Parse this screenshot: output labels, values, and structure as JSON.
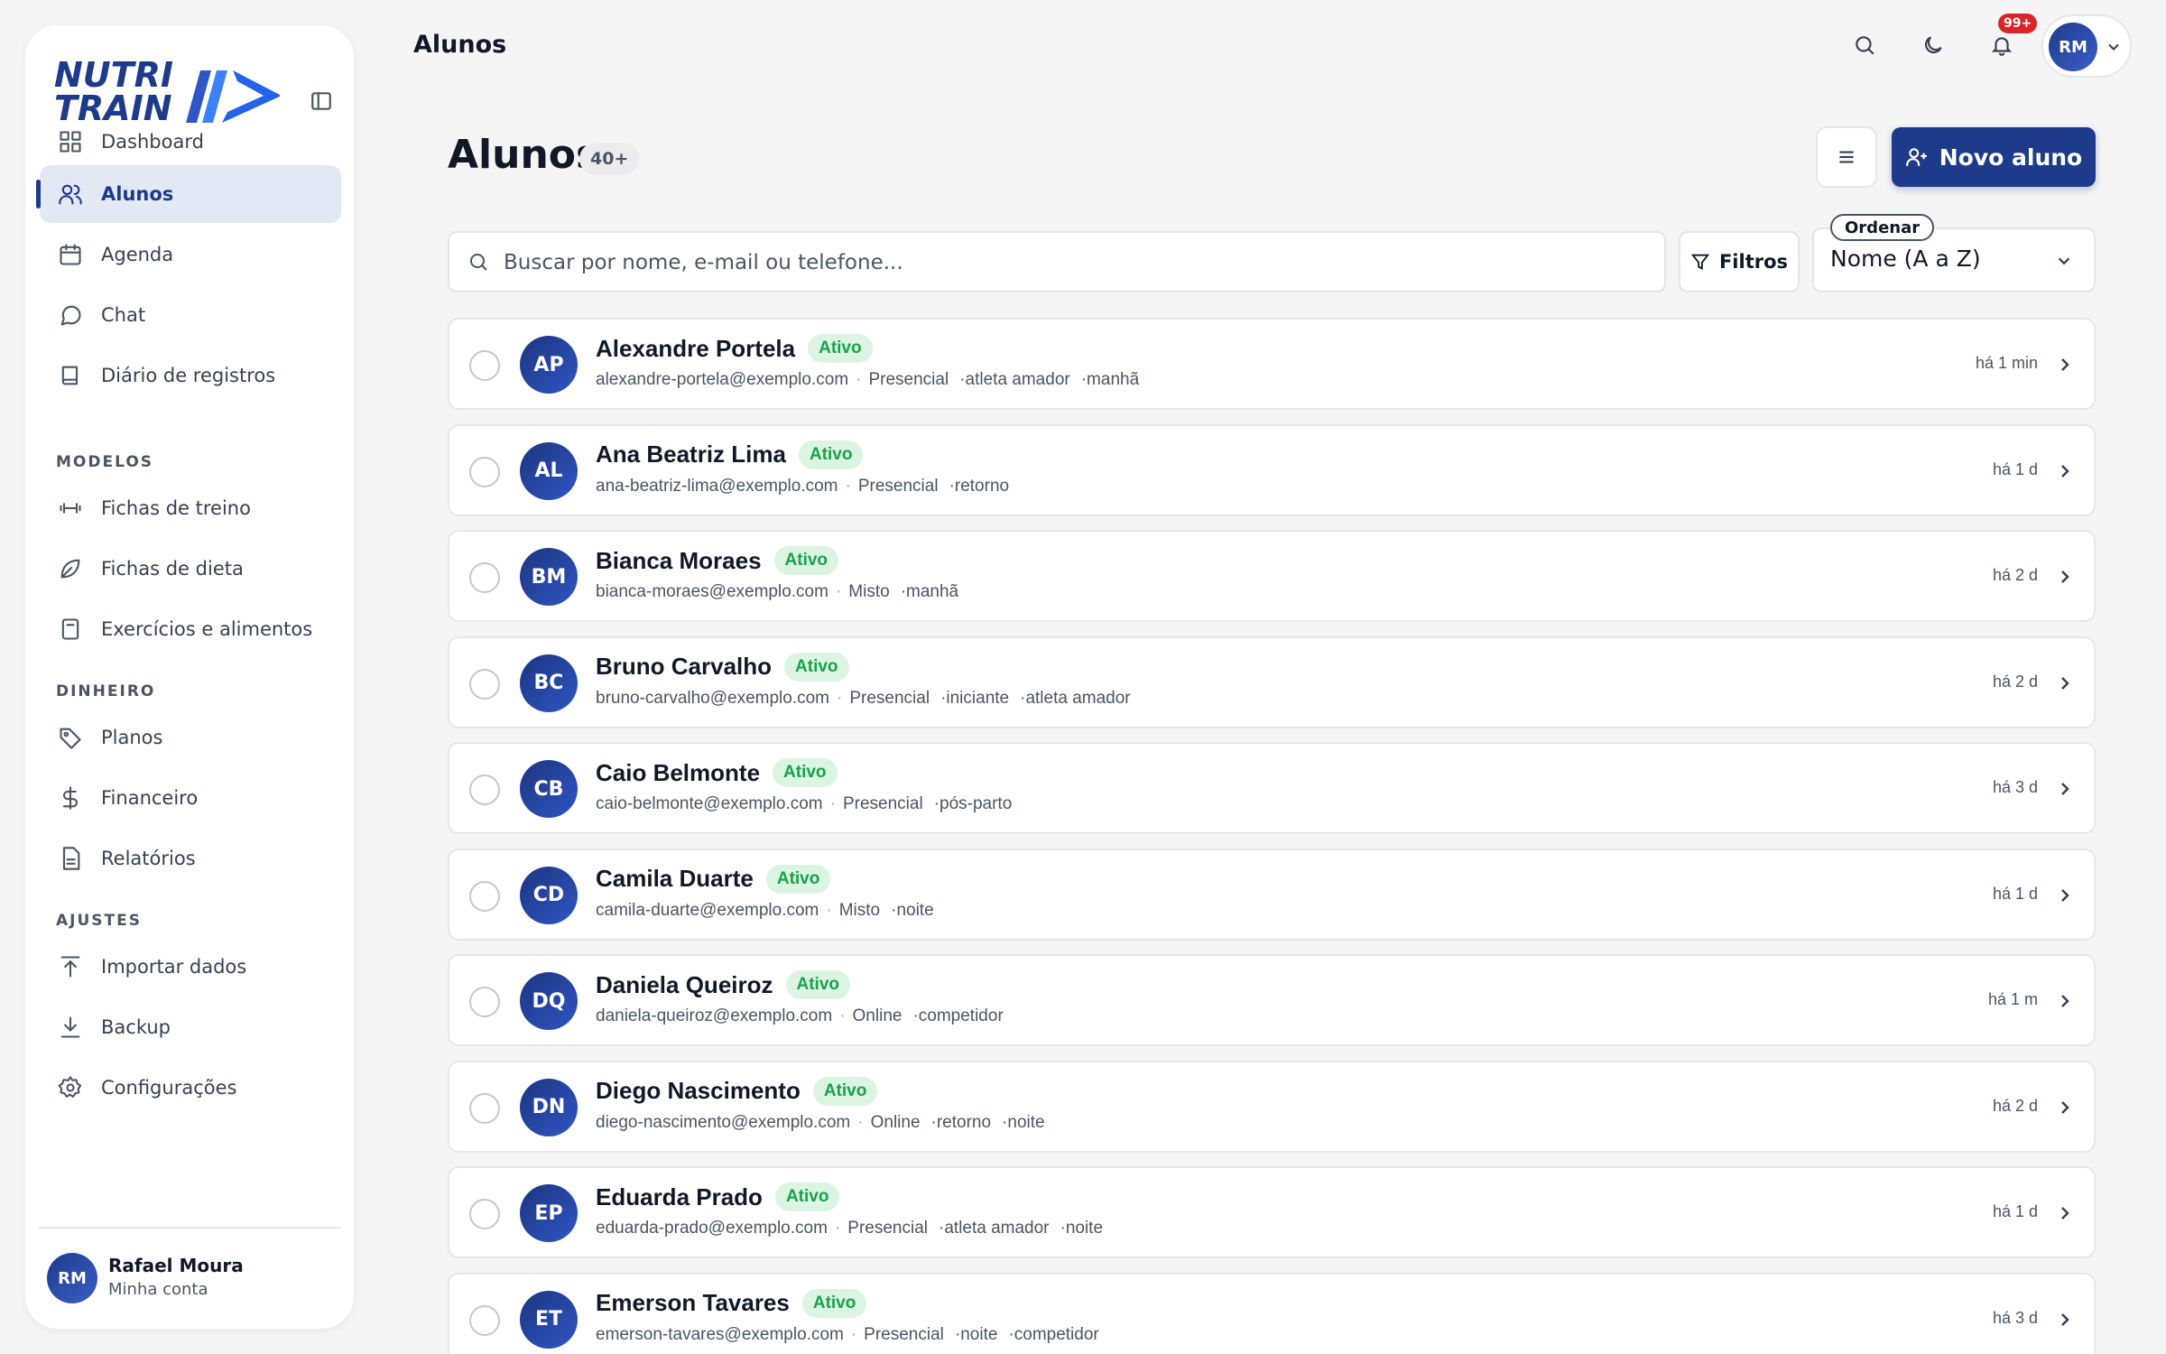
{
  "brand": {
    "line1": "NUTRI",
    "line2": "TRAIN"
  },
  "sidebar": {
    "main_items": [
      {
        "label": "Dashboard",
        "icon": "grid-icon"
      },
      {
        "label": "Alunos",
        "icon": "users-icon",
        "active": true
      },
      {
        "label": "Agenda",
        "icon": "calendar-icon"
      },
      {
        "label": "Chat",
        "icon": "chat-icon"
      },
      {
        "label": "Diário de registros",
        "icon": "book-icon"
      }
    ],
    "section_modelos": "MODELOS",
    "modelos_items": [
      {
        "label": "Fichas de treino",
        "icon": "dumbbell-icon"
      },
      {
        "label": "Fichas de dieta",
        "icon": "leaf-icon"
      },
      {
        "label": "Exercícios e alimentos",
        "icon": "notebook-icon"
      }
    ],
    "section_dinheiro": "DINHEIRO",
    "dinheiro_items": [
      {
        "label": "Planos",
        "icon": "tag-icon"
      },
      {
        "label": "Financeiro",
        "icon": "dollar-icon"
      },
      {
        "label": "Relatórios",
        "icon": "report-icon"
      }
    ],
    "section_ajustes": "AJUSTES",
    "ajustes_items": [
      {
        "label": "Importar dados",
        "icon": "upload-icon"
      },
      {
        "label": "Backup",
        "icon": "download-icon"
      },
      {
        "label": "Configurações",
        "icon": "gear-icon"
      }
    ],
    "account": {
      "initials": "RM",
      "name": "Rafael Moura",
      "subtitle": "Minha conta"
    }
  },
  "topbar": {
    "title": "Alunos",
    "notifications_badge": "99+",
    "user_initials": "RM"
  },
  "header": {
    "title": "Alunos",
    "count": "40+",
    "new_button": "Novo aluno"
  },
  "search": {
    "placeholder": "Buscar por nome, e-mail ou telefone...",
    "value": "",
    "filters_label": "Filtros",
    "sort_label": "Ordenar",
    "sort_value": "Nome (A a Z)"
  },
  "students": [
    {
      "initials": "AP",
      "name": "Alexandre Portela",
      "status": "Ativo",
      "email": "alexandre-portela@exemplo.com",
      "mode": "Presencial",
      "tags": [
        "atleta amador",
        "manhã"
      ],
      "time": "há 1 min"
    },
    {
      "initials": "AL",
      "name": "Ana Beatriz Lima",
      "status": "Ativo",
      "email": "ana-beatriz-lima@exemplo.com",
      "mode": "Presencial",
      "tags": [
        "retorno"
      ],
      "time": "há 1 d"
    },
    {
      "initials": "BM",
      "name": "Bianca Moraes",
      "status": "Ativo",
      "email": "bianca-moraes@exemplo.com",
      "mode": "Misto",
      "tags": [
        "manhã"
      ],
      "time": "há 2 d"
    },
    {
      "initials": "BC",
      "name": "Bruno Carvalho",
      "status": "Ativo",
      "email": "bruno-carvalho@exemplo.com",
      "mode": "Presencial",
      "tags": [
        "iniciante",
        "atleta amador"
      ],
      "time": "há 2 d"
    },
    {
      "initials": "CB",
      "name": "Caio Belmonte",
      "status": "Ativo",
      "email": "caio-belmonte@exemplo.com",
      "mode": "Presencial",
      "tags": [
        "pós-parto"
      ],
      "time": "há 3 d"
    },
    {
      "initials": "CD",
      "name": "Camila Duarte",
      "status": "Ativo",
      "email": "camila-duarte@exemplo.com",
      "mode": "Misto",
      "tags": [
        "noite"
      ],
      "time": "há 1 d"
    },
    {
      "initials": "DQ",
      "name": "Daniela Queiroz",
      "status": "Ativo",
      "email": "daniela-queiroz@exemplo.com",
      "mode": "Online",
      "tags": [
        "competidor"
      ],
      "time": "há 1 m"
    },
    {
      "initials": "DN",
      "name": "Diego Nascimento",
      "status": "Ativo",
      "email": "diego-nascimento@exemplo.com",
      "mode": "Online",
      "tags": [
        "retorno",
        "noite"
      ],
      "time": "há 2 d"
    },
    {
      "initials": "EP",
      "name": "Eduarda Prado",
      "status": "Ativo",
      "email": "eduarda-prado@exemplo.com",
      "mode": "Presencial",
      "tags": [
        "atleta amador",
        "noite"
      ],
      "time": "há 1 d"
    },
    {
      "initials": "ET",
      "name": "Emerson Tavares",
      "status": "Ativo",
      "email": "emerson-tavares@exemplo.com",
      "mode": "Presencial",
      "tags": [
        "noite",
        "competidor"
      ],
      "time": "há 3 d"
    }
  ],
  "colors": {
    "brand": "#1e3a8a",
    "status_active": "#16a34a",
    "badge": "#dc2626"
  }
}
